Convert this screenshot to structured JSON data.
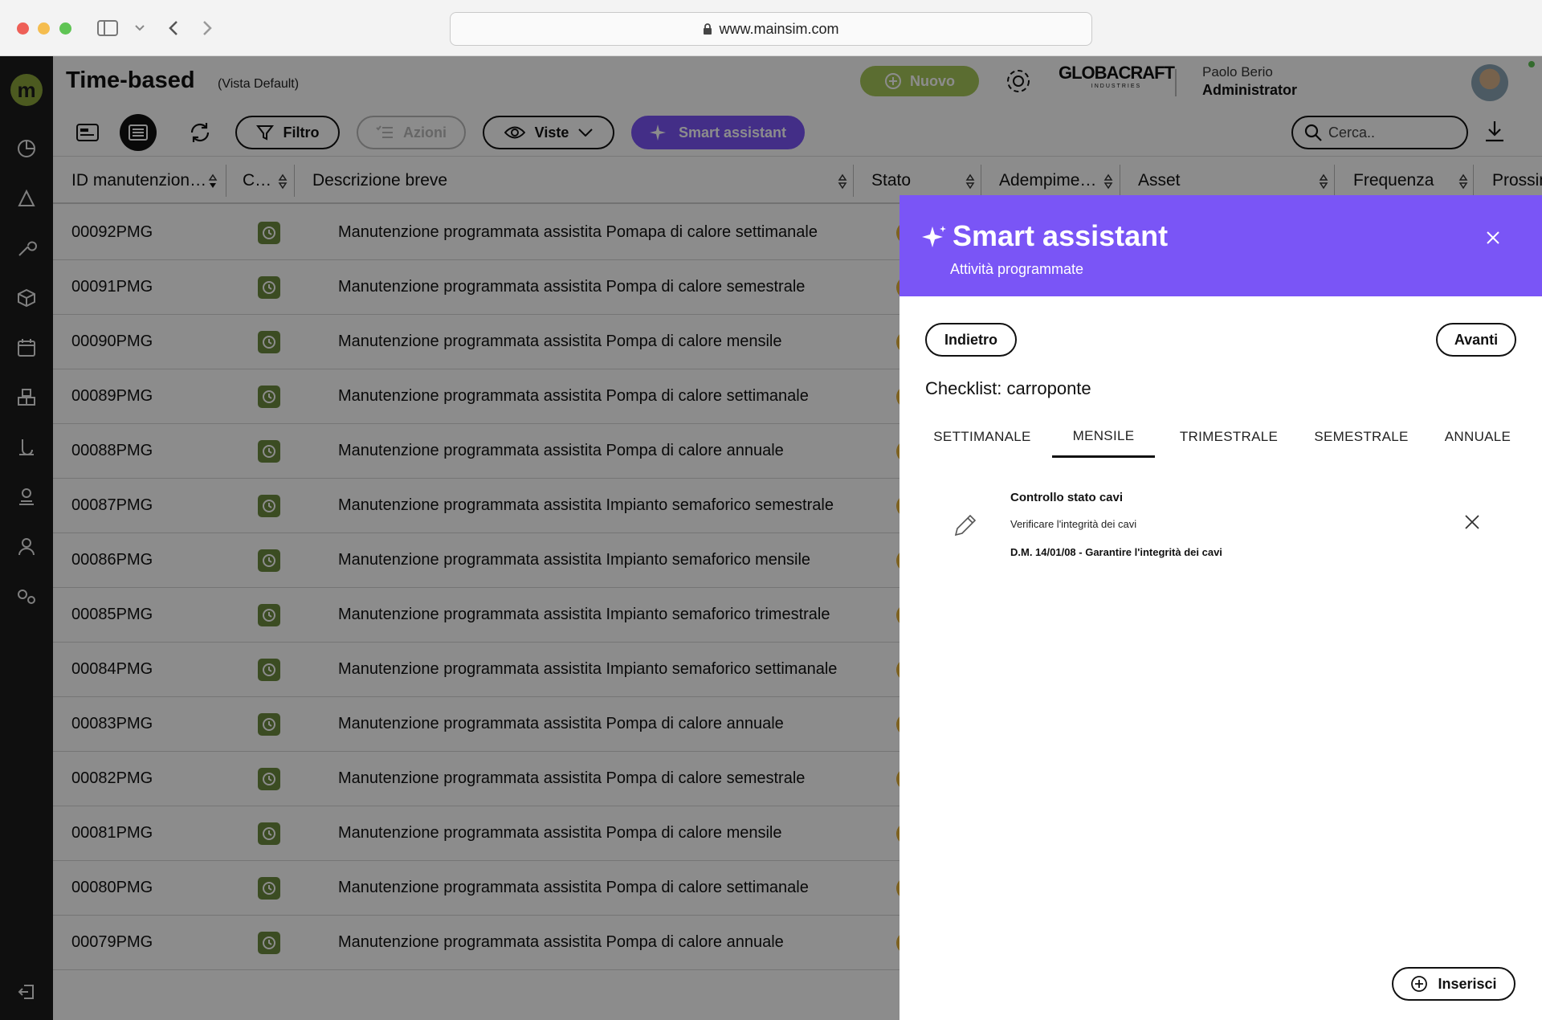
{
  "browser": {
    "url": "www.mainsim.com"
  },
  "header": {
    "title": "Time-based",
    "view_label": "(Vista Default)",
    "new_label": "Nuovo",
    "brand": "GLOBACRAFT",
    "brand_sub": "INDUSTRIES",
    "user_name": "Paolo Berio",
    "user_role": "Administrator"
  },
  "toolbar": {
    "filter_label": "Filtro",
    "actions_label": "Azioni",
    "views_label": "Viste",
    "smart_label": "Smart assistant",
    "search_placeholder": "Cerca.."
  },
  "table": {
    "columns": [
      "ID manutenzion…",
      "C…",
      "Descrizione breve",
      "Stato",
      "Adempime…",
      "Asset",
      "Frequenza",
      "Prossim"
    ],
    "rows": [
      {
        "id": "00092PMG",
        "desc": "Manutenzione programmata assistita Pomapa di calore settimanale"
      },
      {
        "id": "00091PMG",
        "desc": "Manutenzione programmata assistita Pompa di calore semestrale"
      },
      {
        "id": "00090PMG",
        "desc": "Manutenzione programmata assistita Pompa di calore mensile"
      },
      {
        "id": "00089PMG",
        "desc": "Manutenzione programmata assistita Pompa di calore settimanale"
      },
      {
        "id": "00088PMG",
        "desc": "Manutenzione programmata assistita Pompa di calore annuale"
      },
      {
        "id": "00087PMG",
        "desc": "Manutenzione programmata assistita Impianto semaforico semestrale"
      },
      {
        "id": "00086PMG",
        "desc": "Manutenzione programmata assistita Impianto semaforico mensile"
      },
      {
        "id": "00085PMG",
        "desc": "Manutenzione programmata assistita Impianto semaforico trimestrale"
      },
      {
        "id": "00084PMG",
        "desc": "Manutenzione programmata assistita Impianto semaforico settimanale"
      },
      {
        "id": "00083PMG",
        "desc": "Manutenzione programmata assistita Pompa di calore annuale"
      },
      {
        "id": "00082PMG",
        "desc": "Manutenzione programmata assistita Pompa di calore semestrale"
      },
      {
        "id": "00081PMG",
        "desc": "Manutenzione programmata assistita Pompa di calore mensile"
      },
      {
        "id": "00080PMG",
        "desc": "Manutenzione programmata assistita Pompa di calore settimanale"
      },
      {
        "id": "00079PMG",
        "desc": "Manutenzione programmata assistita Pompa di calore annuale"
      }
    ]
  },
  "panel": {
    "title": "Smart assistant",
    "subtitle": "Attività programmate",
    "back_label": "Indietro",
    "next_label": "Avanti",
    "checklist_title": "Checklist: carroponte",
    "tabs": [
      "SETTIMANALE",
      "MENSILE",
      "TRIMESTRALE",
      "SEMESTRALE",
      "ANNUALE"
    ],
    "active_tab": "MENSILE",
    "item": {
      "title": "Controllo stato cavi",
      "desc": "Verificare l'integrità dei cavi",
      "ref": "D.M. 14/01/08 - Garantire l'integrità dei cavi"
    },
    "insert_label": "Inserisci"
  },
  "colors": {
    "accent": "#7a55f6",
    "brand_green": "#8aa43b",
    "status_amber": "#e5b33b"
  }
}
